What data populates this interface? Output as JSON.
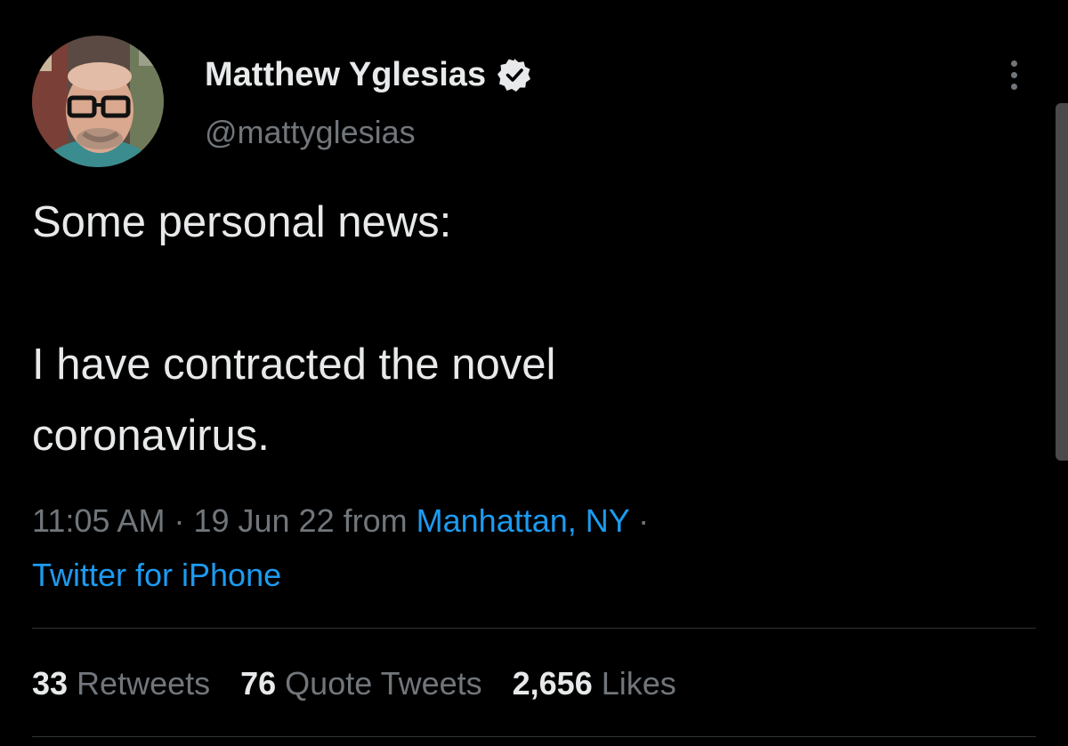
{
  "author": {
    "display_name": "Matthew Yglesias",
    "handle": "@mattyglesias",
    "verified": true,
    "avatar_icon": "profile-photo"
  },
  "tweet": {
    "lines": [
      "Some personal news:",
      "",
      "I have contracted the novel",
      "coronavirus."
    ]
  },
  "meta": {
    "time": "11:05 AM",
    "separator": "·",
    "date": "19 Jun 22",
    "from_label": "from",
    "location": "Manhattan, NY",
    "source": "Twitter for iPhone"
  },
  "stats": {
    "retweets": {
      "count": "33",
      "label": "Retweets"
    },
    "quotes": {
      "count": "76",
      "label": "Quote Tweets"
    },
    "likes": {
      "count": "2,656",
      "label": "Likes"
    }
  },
  "colors": {
    "background": "#000000",
    "primary_text": "#e7e9ea",
    "secondary_text": "#71767b",
    "link": "#1d9bf0",
    "divider": "#2f3336"
  },
  "icons": {
    "verified": "verified-badge-icon",
    "more": "more-options-icon"
  }
}
